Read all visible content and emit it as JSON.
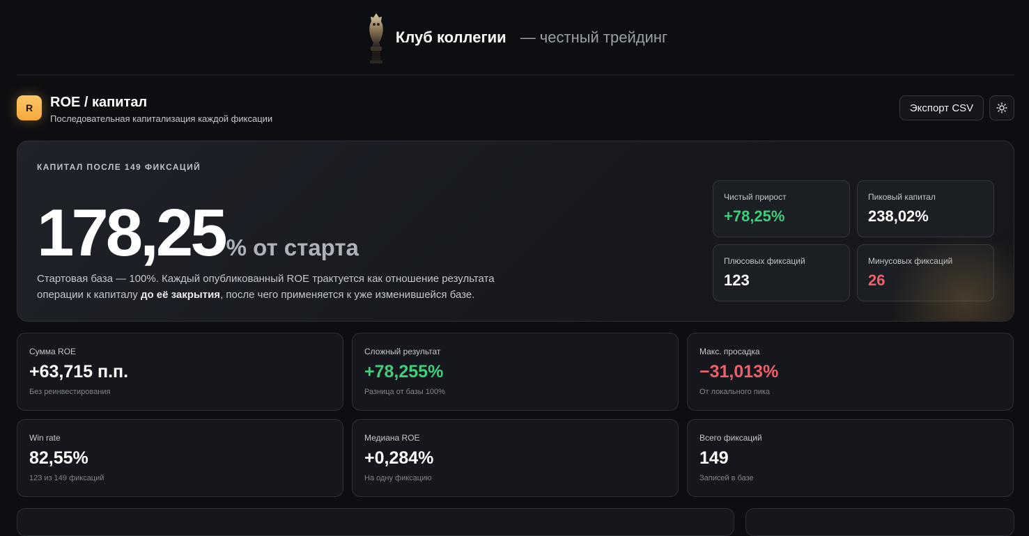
{
  "topbar": {
    "brand": "Клуб коллегии",
    "brand_sub": "— честный трейдинг"
  },
  "header": {
    "badge": "R",
    "title": "ROE / капитал",
    "subtitle": "Последовательная капитализация каждой фиксации",
    "export_label": "Экспорт CSV",
    "theme_icon": "sun-icon"
  },
  "hero": {
    "label": "КАПИТАЛ ПОСЛЕ 149 ФИКСАЦИЙ",
    "big_value": "178,25",
    "big_suffix": "% от старта",
    "desc_part1": "Стартовая база — 100%. Каждый опубликованный ROE трактуется как отношение результата операции к капиталу ",
    "desc_bold": "до её закрытия",
    "desc_part2": ", после чего применяется к уже изменившейся базе.",
    "stats": [
      {
        "label": "Чистый прирост",
        "value": "+78,25%",
        "tone": "green"
      },
      {
        "label": "Пиковый капитал",
        "value": "238,02%",
        "tone": "white"
      },
      {
        "label": "Плюсовых фиксаций",
        "value": "123",
        "tone": "white"
      },
      {
        "label": "Минусовых фиксаций",
        "value": "26",
        "tone": "red"
      }
    ]
  },
  "cards": [
    {
      "label": "Сумма ROE",
      "value": "+63,715 п.п.",
      "note": "Без реинвестирования",
      "tone": "white"
    },
    {
      "label": "Сложный результат",
      "value": "+78,255%",
      "note": "Разница от базы 100%",
      "tone": "green"
    },
    {
      "label": "Макс. просадка",
      "value": "−31,013%",
      "note": "От локального пика",
      "tone": "red"
    },
    {
      "label": "Win rate",
      "value": "82,55%",
      "note": "123 из 149 фиксаций",
      "tone": "white"
    },
    {
      "label": "Медиана ROE",
      "value": "+0,284%",
      "note": "На одну фиксацию",
      "tone": "white"
    },
    {
      "label": "Всего фиксаций",
      "value": "149",
      "note": "Записей в базе",
      "tone": "white"
    }
  ],
  "colors": {
    "accent": "#f5a93c",
    "positive": "#3ecf7a",
    "negative": "#f0606a",
    "background": "#0d0e12"
  }
}
